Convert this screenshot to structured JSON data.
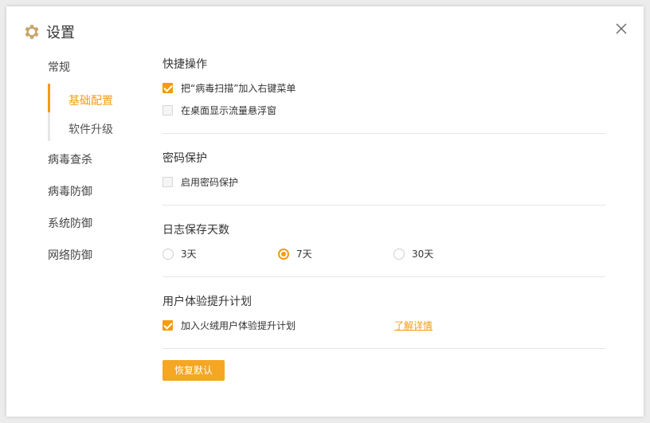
{
  "window": {
    "title": "设置"
  },
  "icons": {
    "app": "gear-icon",
    "close": "close-icon"
  },
  "colors": {
    "accent": "#f39c12",
    "button": "#f5a623"
  },
  "sidebar": {
    "items": [
      {
        "label": "常规"
      },
      {
        "label": "病毒查杀"
      },
      {
        "label": "病毒防御"
      },
      {
        "label": "系统防御"
      },
      {
        "label": "网络防御"
      }
    ],
    "sub_items": [
      {
        "label": "基础配置",
        "active": true
      },
      {
        "label": "软件升级",
        "active": false
      }
    ]
  },
  "sections": {
    "shortcut": {
      "title": "快捷操作",
      "options": [
        {
          "label": "把“病毒扫描”加入右键菜单",
          "checked": true
        },
        {
          "label": "在桌面显示流量悬浮窗",
          "checked": false
        }
      ]
    },
    "password": {
      "title": "密码保护",
      "options": [
        {
          "label": "启用密码保护",
          "checked": false
        }
      ]
    },
    "log": {
      "title": "日志保存天数",
      "options": [
        {
          "label": "3天",
          "selected": false
        },
        {
          "label": "7天",
          "selected": true
        },
        {
          "label": "30天",
          "selected": false
        }
      ]
    },
    "ux": {
      "title": "用户体验提升计划",
      "options": [
        {
          "label": "加入火绒用户体验提升计划",
          "checked": true
        }
      ],
      "link": "了解详情"
    }
  },
  "buttons": {
    "restore_default": "恢复默认"
  }
}
